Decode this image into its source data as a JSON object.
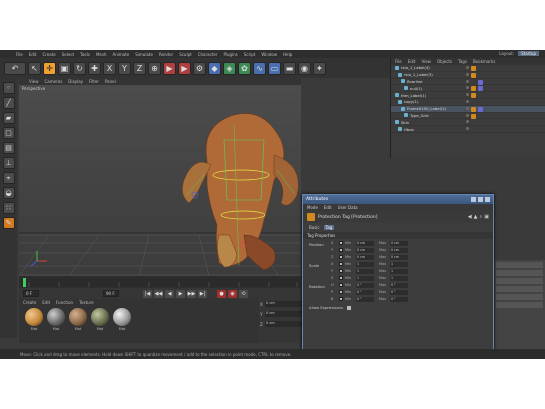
{
  "menubar": {
    "items": [
      "File",
      "Edit",
      "Create",
      "Select",
      "Tools",
      "Mesh",
      "Animate",
      "Simulate",
      "Render",
      "Sculpt",
      "Character",
      "Plugins",
      "Script",
      "Window",
      "Help"
    ],
    "layout_label": "Layout:",
    "layout_value": "Startup"
  },
  "toolbar": {
    "icons": [
      "undo-icon",
      "select-icon",
      "move-icon",
      "scale-icon",
      "rotate-icon",
      "create-icon",
      "x-axis-icon",
      "y-axis-icon",
      "z-axis-icon",
      "coord-icon",
      "render-view-icon",
      "render-icon",
      "render-settings-icon",
      "cube-icon",
      "subdivision-icon",
      "array-icon",
      "spline-icon",
      "deformer-icon",
      "floor-icon",
      "camera-icon",
      "light-icon"
    ],
    "glyphs": [
      "↶",
      "↖",
      "✛",
      "▣",
      "↻",
      "✚",
      "X",
      "Y",
      "Z",
      "⊕",
      "▶",
      "▶",
      "⚙",
      "◆",
      "◈",
      "✿",
      "∿",
      "▭",
      "▬",
      "◉",
      "✦"
    ]
  },
  "left_tools": {
    "icons": [
      "points-icon",
      "edges-icon",
      "polygons-icon",
      "model-icon",
      "texture-icon",
      "axis-icon",
      "snap-icon",
      "magnet-icon",
      "tweak-icon",
      "paint-icon"
    ],
    "glyphs": [
      "◦",
      "╱",
      "▰",
      "▢",
      "▤",
      "⊥",
      "⌖",
      "◒",
      "∷",
      "✎"
    ]
  },
  "viewport": {
    "menu": [
      "View",
      "Cameras",
      "Display",
      "Filter",
      "Panel"
    ],
    "label": "Perspective"
  },
  "playbar": {
    "start_frame": "0 F",
    "end_frame": "90 F",
    "buttons": [
      "|◀",
      "◀◀",
      "◀",
      "▶",
      "▶▶",
      "▶|"
    ],
    "record_icons": [
      "●",
      "◉",
      "⟲"
    ]
  },
  "materials": {
    "menu": [
      "Create",
      "Edit",
      "Function",
      "Texture"
    ],
    "items": [
      {
        "name": "Mat",
        "color": "#c68a3a"
      },
      {
        "name": "Mat",
        "color": "#6a6a6a"
      },
      {
        "name": "Mat",
        "color": "#8a6a4a"
      },
      {
        "name": "Mat",
        "color": "#6a7050"
      },
      {
        "name": "Mat",
        "color": "#9a9a9a"
      }
    ]
  },
  "coords": {
    "rows": [
      {
        "axis": "X",
        "value": "0 cm"
      },
      {
        "axis": "Y",
        "value": "0 cm"
      },
      {
        "axis": "Z",
        "value": "0 cm"
      }
    ]
  },
  "object_manager": {
    "menu": [
      "File",
      "Edit",
      "View",
      "Objects",
      "Tags",
      "Bookmarks"
    ],
    "rows": [
      {
        "name": "rsio_1_Label(4)",
        "highlight": false,
        "tag": true,
        "tag2": false
      },
      {
        "name": "rsio_1_Label(3)",
        "highlight": false,
        "tag": true,
        "tag2": false
      },
      {
        "name": "floorline",
        "highlight": false,
        "tag": false,
        "tag2": true
      },
      {
        "name": "null(1)",
        "highlight": false,
        "tag": true,
        "tag2": true
      },
      {
        "name": "thm_Label(1)",
        "highlight": false,
        "tag": true,
        "tag2": false
      },
      {
        "name": "copy(1)",
        "highlight": false,
        "tag": false,
        "tag2": false
      },
      {
        "name": "Frame0100_Label(1)",
        "highlight": true,
        "tag": true,
        "tag2": true
      },
      {
        "name": "Type_Grid",
        "highlight": false,
        "tag": true,
        "tag2": false
      },
      {
        "name": "Skin",
        "highlight": false,
        "tag": false,
        "tag2": false
      },
      {
        "name": "Hbox",
        "highlight": false,
        "tag": false,
        "tag2": false
      }
    ]
  },
  "attribute_dialog": {
    "title": "Attributes",
    "menu": [
      "Mode",
      "Edit",
      "User Data"
    ],
    "object_title": "Protection Tag [Protection]",
    "tabs": [
      {
        "label": "Basic",
        "active": false
      },
      {
        "label": "Tag",
        "active": true
      }
    ],
    "section": "Tag Properties",
    "groups": [
      {
        "label": "Position",
        "rows": [
          {
            "axis": "X",
            "min": "0 cm",
            "max": "0 cm"
          },
          {
            "axis": "Y",
            "min": "0 cm",
            "max": "0 cm"
          },
          {
            "axis": "Z",
            "min": "0 cm",
            "max": "0 cm"
          }
        ]
      },
      {
        "label": "Scale",
        "rows": [
          {
            "axis": "X",
            "min": "1",
            "max": "1"
          },
          {
            "axis": "Y",
            "min": "1",
            "max": "1"
          },
          {
            "axis": "Z",
            "min": "1",
            "max": "1"
          }
        ]
      },
      {
        "label": "Rotation",
        "rows": [
          {
            "axis": "H",
            "min": "0 °",
            "max": "0 °"
          },
          {
            "axis": "P",
            "min": "0 °",
            "max": "0 °"
          },
          {
            "axis": "B",
            "min": "0 °",
            "max": "0 °"
          }
        ]
      }
    ],
    "min_label": "Min",
    "max_label": "Max",
    "footer_label": "Allow Expressions"
  },
  "status": {
    "text": "Move: Click and drag to move elements. Hold down SHIFT to quantize movement / add to the selection in point mode, CTRL to remove."
  }
}
